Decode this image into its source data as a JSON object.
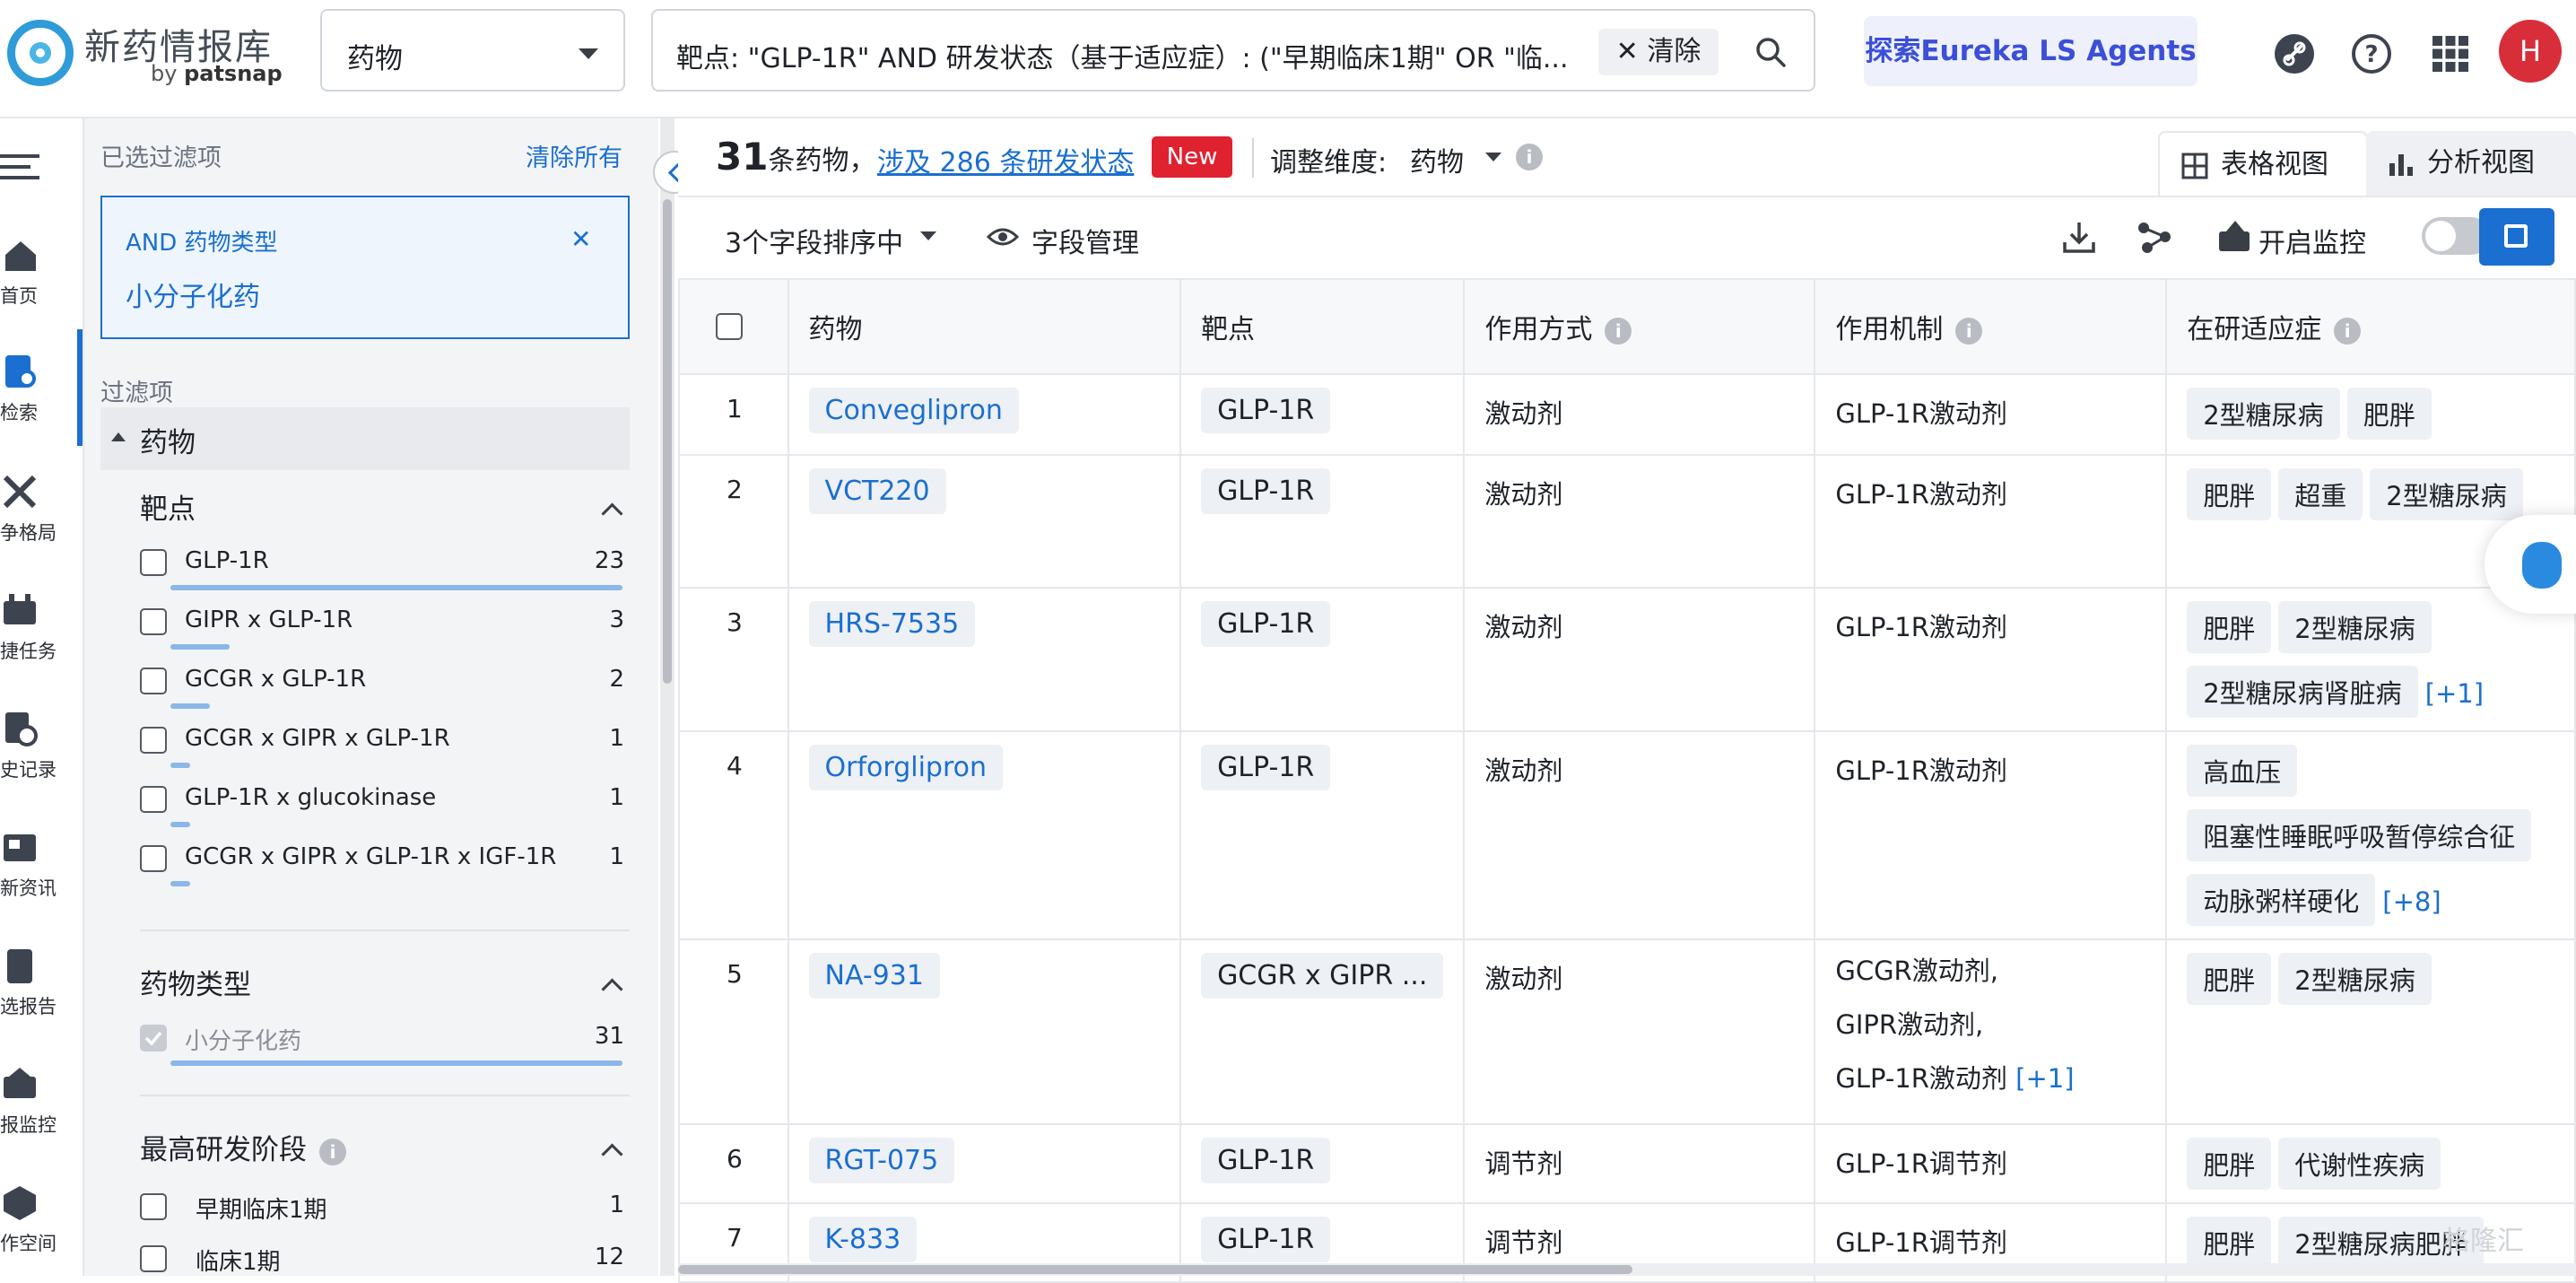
{
  "app": {
    "name": "新药情报库",
    "by": "by",
    "vendor": "patsnap"
  },
  "search": {
    "type": "药物",
    "query": "靶点: \"GLP-1R\" AND 研发状态（基于适应症）: (\"早期临床1期\" OR \"临...",
    "clear_label": "清除"
  },
  "header": {
    "agents_label": "探索Eureka LS Agents",
    "avatar_letter": "H"
  },
  "nav": [
    {
      "label": "首页",
      "icon": "home-icon"
    },
    {
      "label": "检索",
      "icon": "search-doc-icon"
    },
    {
      "label": "争格局",
      "icon": "swords-icon"
    },
    {
      "label": "捷任务",
      "icon": "task-icon"
    },
    {
      "label": "史记录",
      "icon": "history-icon"
    },
    {
      "label": "新资讯",
      "icon": "news-icon"
    },
    {
      "label": "选报告",
      "icon": "report-icon"
    },
    {
      "label": "报监控",
      "icon": "monitor-icon"
    },
    {
      "label": "作空间",
      "icon": "workspace-icon"
    }
  ],
  "filters": {
    "selected_title": "已选过滤项",
    "clear_all": "清除所有",
    "applied": {
      "op": "AND 药物类型",
      "value": "小分子化药"
    },
    "filter_title": "过滤项",
    "group": "药物",
    "sections": [
      {
        "title": "靶点",
        "items": [
          {
            "label": "GLP-1R",
            "count": "23"
          },
          {
            "label": "GIPR x GLP-1R",
            "count": "3"
          },
          {
            "label": "GCGR x GLP-1R",
            "count": "2"
          },
          {
            "label": "GCGR x GIPR x GLP-1R",
            "count": "1"
          },
          {
            "label": "GLP-1R x glucokinase",
            "count": "1"
          },
          {
            "label": "GCGR x GIPR x GLP-1R x IGF-1R",
            "count": "1"
          }
        ]
      },
      {
        "title": "药物类型",
        "items": [
          {
            "label": "小分子化药",
            "count": "31",
            "checked": true
          }
        ]
      },
      {
        "title": "最高研发阶段",
        "items": [
          {
            "label": "早期临床1期",
            "count": "1"
          },
          {
            "label": "临床1期",
            "count": "12"
          }
        ]
      }
    ]
  },
  "results": {
    "count": "31",
    "count_suffix": "条药物，",
    "status_link": "涉及 286 条研发状态",
    "new_badge": "New",
    "dimension_label": "调整维度:",
    "dimension_value": "药物",
    "table_view": "表格视图",
    "analysis_view": "分析视图",
    "sort_label": "3个字段排序中",
    "field_mgmt": "字段管理",
    "monitor_label": "开启监控"
  },
  "table": {
    "columns": [
      "药物",
      "靶点",
      "作用方式",
      "作用机制",
      "在研适应症"
    ],
    "rows": [
      {
        "n": "1",
        "drug": "Conveglipron",
        "target": "GLP-1R",
        "mode": "激动剂",
        "mech": [
          "GLP-1R激动剂"
        ],
        "mech_more": "",
        "ind": [
          "2型糖尿病",
          "肥胖"
        ],
        "ind_more": ""
      },
      {
        "n": "2",
        "drug": "VCT220",
        "target": "GLP-1R",
        "mode": "激动剂",
        "mech": [
          "GLP-1R激动剂"
        ],
        "mech_more": "",
        "ind": [
          "肥胖",
          "超重",
          "2型糖尿病"
        ],
        "ind_more": ""
      },
      {
        "n": "3",
        "drug": "HRS-7535",
        "target": "GLP-1R",
        "mode": "激动剂",
        "mech": [
          "GLP-1R激动剂"
        ],
        "mech_more": "",
        "ind": [
          "肥胖",
          "2型糖尿病",
          "2型糖尿病肾脏病"
        ],
        "ind_more": "[+1]"
      },
      {
        "n": "4",
        "drug": "Orforglipron",
        "target": "GLP-1R",
        "mode": "激动剂",
        "mech": [
          "GLP-1R激动剂"
        ],
        "mech_more": "",
        "ind": [
          "高血压",
          "阻塞性睡眠呼吸暂停综合征",
          "动脉粥样硬化"
        ],
        "ind_more": "[+8]"
      },
      {
        "n": "5",
        "drug": "NA-931",
        "target": "GCGR x GIPR ...",
        "mode": "激动剂",
        "mech": [
          "GCGR激动剂,",
          "GIPR激动剂,",
          "GLP-1R激动剂"
        ],
        "mech_more": "[+1]",
        "ind": [
          "肥胖",
          "2型糖尿病"
        ],
        "ind_more": ""
      },
      {
        "n": "6",
        "drug": "RGT-075",
        "target": "GLP-1R",
        "mode": "调节剂",
        "mech": [
          "GLP-1R调节剂"
        ],
        "mech_more": "",
        "ind": [
          "肥胖",
          "代谢性疾病"
        ],
        "ind_more": ""
      },
      {
        "n": "7",
        "drug": "K-833",
        "target": "GLP-1R",
        "mode": "调节剂",
        "mech": [
          "GLP-1R调节剂"
        ],
        "mech_more": "",
        "ind": [
          "肥胖",
          "2型糖尿病肥胖"
        ],
        "ind_more": ""
      }
    ]
  },
  "watermark": "格隆汇"
}
